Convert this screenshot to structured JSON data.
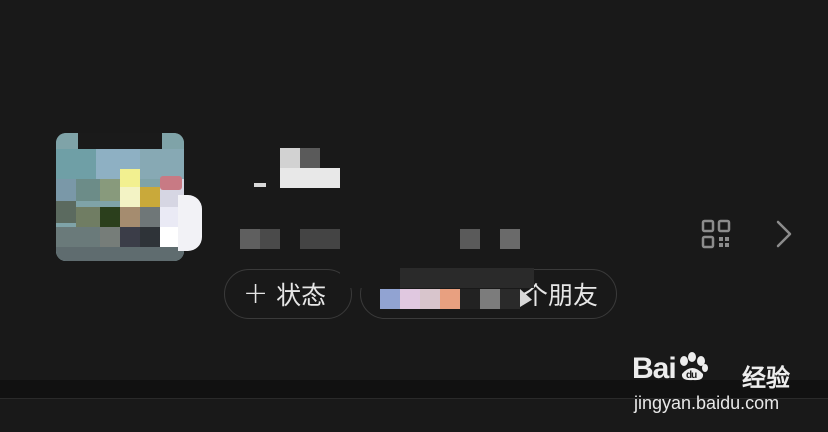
{
  "profile": {
    "status_button": {
      "icon": "plus-icon",
      "label": "状态"
    },
    "friends_button": {
      "label": "个朋友"
    },
    "qr_code_icon": "qr-code-icon",
    "arrow_icon": "chevron-right-icon"
  },
  "watermark": {
    "brand": "Bai",
    "brand_suffix": "du",
    "product": "经验",
    "url": "jingyan.baidu.com"
  },
  "colors": {
    "background": "#191919",
    "pill_border": "#3a3a3a",
    "text": "#e6e6e6",
    "icon": "#8c8c8c"
  }
}
